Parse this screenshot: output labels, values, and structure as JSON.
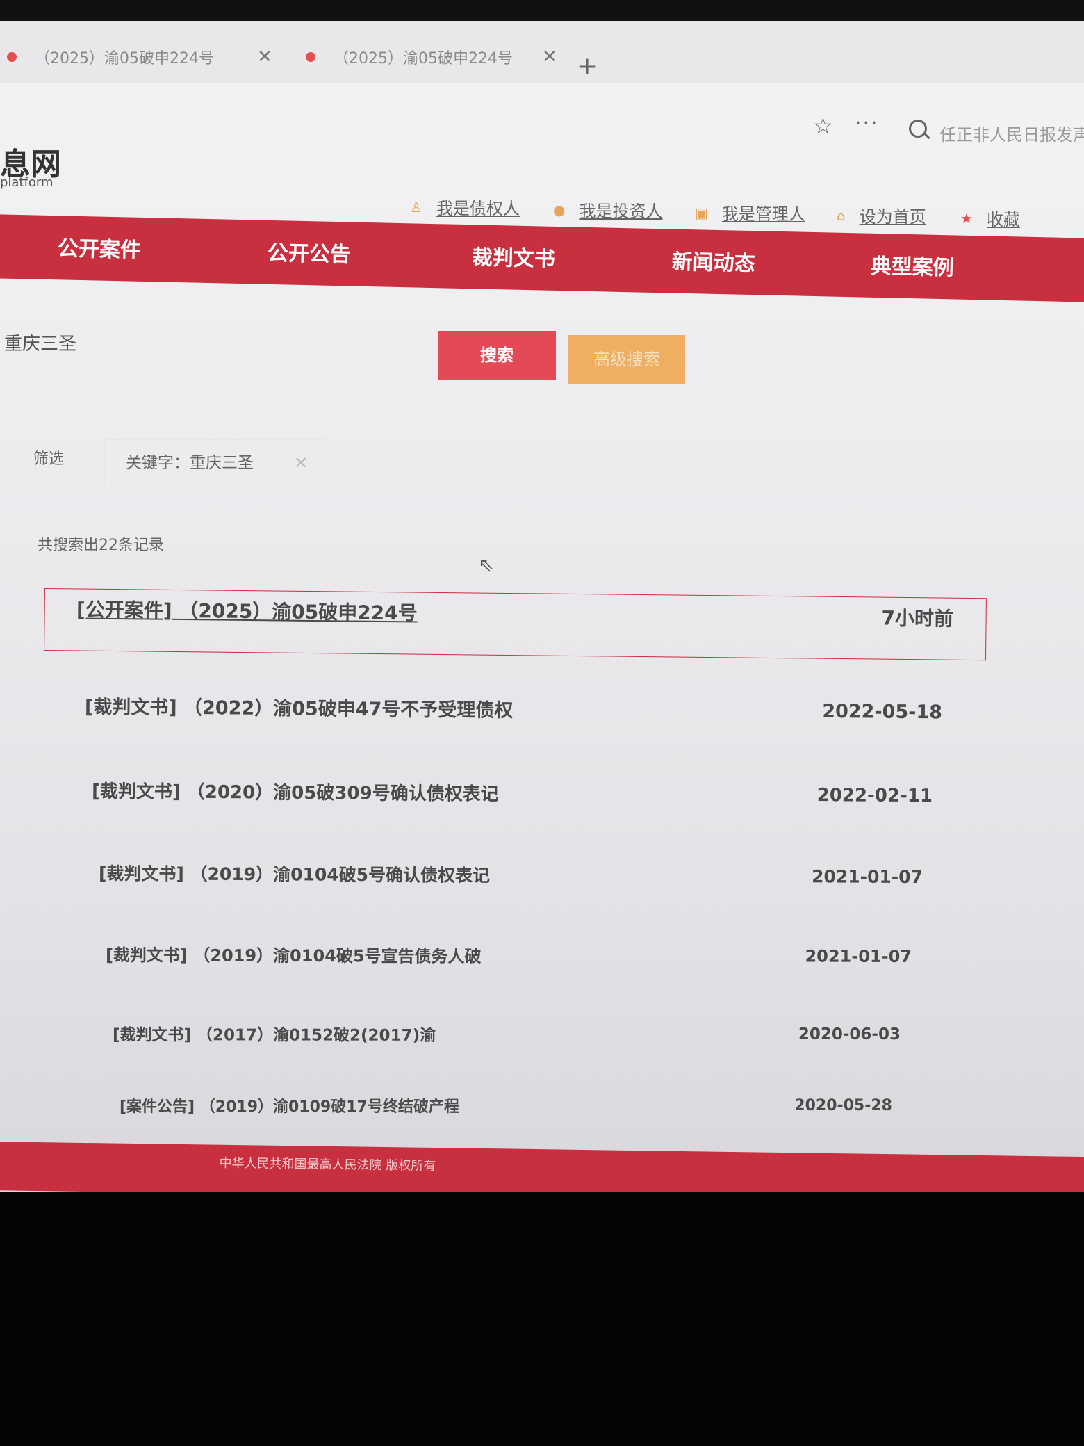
{
  "tabs": [
    {
      "label": "（2025）渝05破申224号"
    },
    {
      "label": "（2025）渝05破申224号"
    }
  ],
  "toolbar": {
    "address_text": "任正非人民日报发声"
  },
  "site": {
    "logo_text": "息网",
    "logo_sub": "platform"
  },
  "user_links": [
    {
      "label": "我是债权人",
      "icon": "person-icon"
    },
    {
      "label": "我是投资人",
      "icon": "investor-icon"
    },
    {
      "label": "我是管理人",
      "icon": "manager-icon"
    },
    {
      "label": "设为首页",
      "icon": "home-icon"
    },
    {
      "label": "收藏",
      "icon": "star-icon"
    }
  ],
  "nav": [
    {
      "label": "公开案件"
    },
    {
      "label": "公开公告"
    },
    {
      "label": "裁判文书"
    },
    {
      "label": "新闻动态"
    },
    {
      "label": "典型案例"
    }
  ],
  "search": {
    "value": "重庆三圣",
    "button_label": "搜索",
    "advanced_label": "高级搜索"
  },
  "filter": {
    "label": "筛选",
    "chip": "关键字：重庆三圣"
  },
  "result_count": "共搜索出22条记录",
  "results": [
    {
      "title": "[公开案件] （2025）渝05破申224号",
      "date": "7小时前"
    },
    {
      "title": "[裁判文书] （2022）渝05破申47号不予受理债权",
      "date": "2022-05-18"
    },
    {
      "title": "[裁判文书] （2020）渝05破309号确认债权表记",
      "date": "2022-02-11"
    },
    {
      "title": "[裁判文书] （2019）渝0104破5号确认债权表记",
      "date": "2021-01-07"
    },
    {
      "title": "[裁判文书] （2019）渝0104破5号宣告债务人破",
      "date": "2021-01-07"
    },
    {
      "title": "[裁判文书] （2017）渝0152破2(2017)渝",
      "date": "2020-06-03"
    },
    {
      "title": "[案件公告] （2019）渝0109破17号终结破产程",
      "date": "2020-05-28"
    }
  ],
  "footer": {
    "copyright": "中华人民共和国最高人民法院 版权所有"
  },
  "colors": {
    "brand_red": "#c8303f",
    "search_button": "#e44a55",
    "advanced_button": "#efae62"
  }
}
